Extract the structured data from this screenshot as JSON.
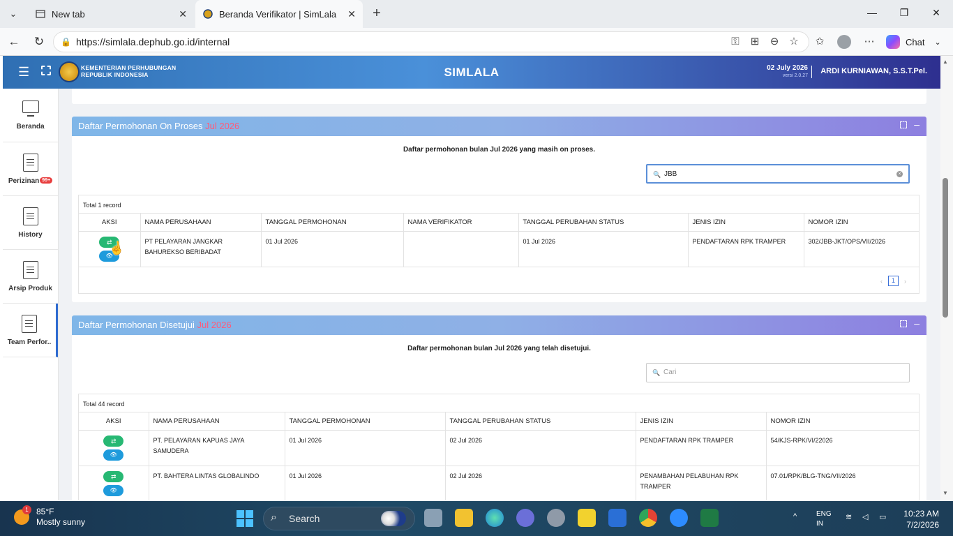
{
  "browser": {
    "tab1": {
      "title": "New tab"
    },
    "tab2": {
      "title": "Beranda Verifikator | SimLala"
    },
    "url": "https://simlala.dephub.go.id/internal",
    "chat_label": "Chat"
  },
  "header": {
    "ministry_line1": "KEMENTERIAN PERHUBUNGAN",
    "ministry_line2": "REPUBLIK INDONESIA",
    "app_title": "SIMLALA",
    "date": "02 July 2026",
    "version": "versi 2.0.27",
    "user": "ARDI KURNIAWAN, S.S.T.Pel."
  },
  "sidebar": {
    "items": [
      {
        "label": "Beranda"
      },
      {
        "label": "Perizinan",
        "badge": "99+"
      },
      {
        "label": "History"
      },
      {
        "label": "Arsip Produk"
      },
      {
        "label": "Team Perfor.."
      }
    ]
  },
  "panel1": {
    "title": "Daftar Permohonan On Proses",
    "month": "Jul 2026",
    "description": "Daftar permohonan bulan Jul 2026 yang masih on proses.",
    "search_value": "JBB",
    "total": "Total 1 record",
    "columns": [
      "AKSI",
      "NAMA PERUSAHAAN",
      "TANGGAL PERMOHONAN",
      "NAMA VERIFIKATOR",
      "TANGGAL PERUBAHAN STATUS",
      "JENIS IZIN",
      "NOMOR IZIN"
    ],
    "rows": [
      {
        "company": "PT PELAYARAN JANGKAR BAHUREKSO BERIBADAT",
        "date_request": "01 Jul 2026",
        "verifier": "",
        "date_status": "01 Jul 2026",
        "license_type": "PENDAFTARAN RPK TRAMPER",
        "license_no": "302/JBB-JKT/OPS/VII/2026"
      }
    ],
    "page": "1"
  },
  "panel2": {
    "title": "Daftar Permohonan Disetujui",
    "month": "Jul 2026",
    "description": "Daftar permohonan bulan Jul 2026 yang telah disetujui.",
    "search_placeholder": "Cari",
    "total": "Total 44 record",
    "columns": [
      "AKSI",
      "NAMA PERUSAHAAN",
      "TANGGAL PERMOHONAN",
      "TANGGAL PERUBAHAN STATUS",
      "JENIS IZIN",
      "NOMOR IZIN"
    ],
    "rows": [
      {
        "company": "PT. PELAYARAN KAPUAS JAYA SAMUDERA",
        "date_request": "01 Jul 2026",
        "date_status": "02 Jul 2026",
        "license_type": "PENDAFTARAN RPK TRAMPER",
        "license_no": "54/KJS-RPK/VI/22026"
      },
      {
        "company": "PT. BAHTERA LINTAS GLOBALINDO",
        "date_request": "01 Jul 2026",
        "date_status": "02 Jul 2026",
        "license_type": "PENAMBAHAN PELABUHAN RPK TRAMPER",
        "license_no": "07.01/RPK/BLG-TNG/VII/2026"
      }
    ]
  },
  "taskbar": {
    "weather_temp": "85°F",
    "weather_desc": "Mostly sunny",
    "weather_badge": "1",
    "search_label": "Search",
    "lang": "ENG",
    "region": "IN",
    "time": "10:23 AM",
    "date": "7/2/2026"
  }
}
